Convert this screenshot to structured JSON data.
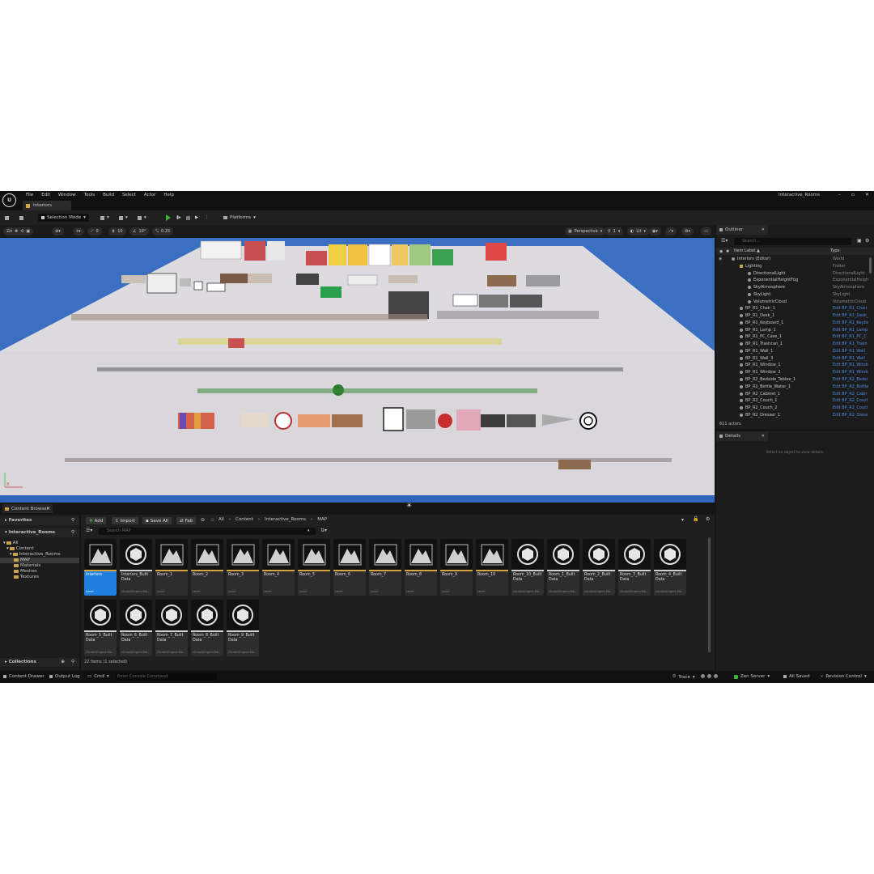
{
  "window": {
    "project": "Interactive_Rooms",
    "doc_tab": "Interiors",
    "controls": [
      "–",
      "▫",
      "✕"
    ]
  },
  "menu": [
    "File",
    "Edit",
    "Window",
    "Tools",
    "Build",
    "Select",
    "Actor",
    "Help"
  ],
  "toolbar": {
    "selection_mode": "Selection Mode",
    "platforms": "Platforms"
  },
  "viewport": {
    "snap_angle": "0",
    "snap_grid": "10",
    "rotate_snap": "10°",
    "scale_snap": "0.25",
    "view_mode": "Perspective",
    "lit": "Lit",
    "cam_speed": "1",
    "axis_x": "X",
    "axis_y": "Y"
  },
  "outliner": {
    "title": "Outliner",
    "search_placeholder": "Search...",
    "col_label": "Item Label ▲",
    "col_type": "Type",
    "rows": [
      {
        "label": "Interiors (Editor)",
        "type": "World",
        "indent": 0,
        "folder": false,
        "link": false
      },
      {
        "label": "Lighting",
        "type": "Folder",
        "indent": 1,
        "folder": true,
        "link": false
      },
      {
        "label": "DirectionalLight",
        "type": "DirectionalLight",
        "indent": 2,
        "folder": false,
        "link": false
      },
      {
        "label": "ExponentialHeightFog",
        "type": "ExponentialHeight",
        "indent": 2,
        "folder": false,
        "link": false
      },
      {
        "label": "SkyAtmosphere",
        "type": "SkyAtmosphere",
        "indent": 2,
        "folder": false,
        "link": false
      },
      {
        "label": "SkyLight",
        "type": "SkyLight",
        "indent": 2,
        "folder": false,
        "link": false
      },
      {
        "label": "VolumetricCloud",
        "type": "VolumetricCloud",
        "indent": 2,
        "folder": false,
        "link": false
      },
      {
        "label": "BP_R1_Chair_1",
        "type": "Edit BP_R1_Chair",
        "indent": 1,
        "folder": false,
        "link": true
      },
      {
        "label": "BP_R1_Desk_1",
        "type": "Edit BP_R1_Desk_",
        "indent": 1,
        "folder": false,
        "link": true
      },
      {
        "label": "BP_R1_Keyboard_1",
        "type": "Edit BP_R1_Keybo",
        "indent": 1,
        "folder": false,
        "link": true
      },
      {
        "label": "BP_R1_Lamp_1",
        "type": "Edit BP_R1_Lamp",
        "indent": 1,
        "folder": false,
        "link": true
      },
      {
        "label": "BP_R1_PC_Case_1",
        "type": "Edit BP_R1_PC_C",
        "indent": 1,
        "folder": false,
        "link": true
      },
      {
        "label": "BP_R1_Trashcan_1",
        "type": "Edit BP_R1_Trash",
        "indent": 1,
        "folder": false,
        "link": true
      },
      {
        "label": "BP_R1_Wall_1",
        "type": "Edit BP_R1_Wall_",
        "indent": 1,
        "folder": false,
        "link": true
      },
      {
        "label": "BP_R1_Wall_3",
        "type": "Edit BP_R1_Wall_",
        "indent": 1,
        "folder": false,
        "link": true
      },
      {
        "label": "BP_R1_Window_1",
        "type": "Edit BP_R1_Windo",
        "indent": 1,
        "folder": false,
        "link": true
      },
      {
        "label": "BP_R1_Window_2",
        "type": "Edit BP_R1_Windo",
        "indent": 1,
        "folder": false,
        "link": true
      },
      {
        "label": "BP_R2_Bedside_Tablee_1",
        "type": "Edit BP_R2_Bedsi",
        "indent": 1,
        "folder": false,
        "link": true
      },
      {
        "label": "BP_R2_Bottle_Water_1",
        "type": "Edit BP_R2_Bottle",
        "indent": 1,
        "folder": false,
        "link": true
      },
      {
        "label": "BP_R2_Cabinet_1",
        "type": "Edit BP_R2_Cabir",
        "indent": 1,
        "folder": false,
        "link": true
      },
      {
        "label": "BP_R2_Couch_1",
        "type": "Edit BP_R2_Coucl",
        "indent": 1,
        "folder": false,
        "link": true
      },
      {
        "label": "BP_R2_Couch_2",
        "type": "Edit BP_R2_Coucl",
        "indent": 1,
        "folder": false,
        "link": true
      },
      {
        "label": "BP_R2_Dresser_1",
        "type": "Edit BP_R2_Dress",
        "indent": 1,
        "folder": false,
        "link": true
      }
    ],
    "count": "611 actors"
  },
  "details": {
    "title": "Details",
    "empty": "Select an object to view details."
  },
  "content_browser": {
    "title": "Content Browser",
    "add": "Add",
    "import": "Import",
    "save_all": "Save All",
    "fab": "Fab",
    "breadcrumbs": [
      "All",
      "›",
      "Content",
      "›",
      "Interactive_Rooms",
      "›",
      "MAP"
    ],
    "search_placeholder": "Search MAP",
    "favorites": "Favorites",
    "project_root": "Interactive_Rooms",
    "collections": "Collections",
    "tree": [
      {
        "label": "All",
        "indent": 0,
        "selected": false
      },
      {
        "label": "Content",
        "indent": 1,
        "selected": false
      },
      {
        "label": "Interactive_Rooms",
        "indent": 2,
        "selected": false
      },
      {
        "label": "MAP",
        "indent": 3,
        "selected": true
      },
      {
        "label": "Materials",
        "indent": 3,
        "selected": false
      },
      {
        "label": "Meshes",
        "indent": 3,
        "selected": false
      },
      {
        "label": "Textures",
        "indent": 3,
        "selected": false
      }
    ],
    "assets": [
      {
        "name": "Interiors",
        "type": "Level",
        "kind": "level",
        "selected": true
      },
      {
        "name": "Interiors_Built Data",
        "type": "(Script)Engine.Ma...",
        "kind": "data",
        "selected": false
      },
      {
        "name": "Room_1",
        "type": "Level",
        "kind": "level",
        "selected": false
      },
      {
        "name": "Room_2",
        "type": "Level",
        "kind": "level",
        "selected": false
      },
      {
        "name": "Room_3",
        "type": "Level",
        "kind": "level",
        "selected": false
      },
      {
        "name": "Room_4",
        "type": "Level",
        "kind": "level",
        "selected": false
      },
      {
        "name": "Room_5",
        "type": "Level",
        "kind": "level",
        "selected": false
      },
      {
        "name": "Room_6",
        "type": "Level",
        "kind": "level",
        "selected": false
      },
      {
        "name": "Room_7",
        "type": "Level",
        "kind": "level",
        "selected": false
      },
      {
        "name": "Room_8",
        "type": "Level",
        "kind": "level",
        "selected": false
      },
      {
        "name": "Room_9",
        "type": "Level",
        "kind": "level",
        "selected": false
      },
      {
        "name": "Room_10",
        "type": "Level",
        "kind": "level",
        "selected": false
      },
      {
        "name": "Room_10_Built Data",
        "type": "(Script)Engine.Ma...",
        "kind": "data",
        "selected": false
      },
      {
        "name": "Room_1_Built Data",
        "type": "(Script)Engine.Ma...",
        "kind": "data",
        "selected": false
      },
      {
        "name": "Room_2_Built Data",
        "type": "(Script)Engine.Ma...",
        "kind": "data",
        "selected": false
      },
      {
        "name": "Room_3_Built Data",
        "type": "(Script)Engine.Ma...",
        "kind": "data",
        "selected": false
      },
      {
        "name": "Room_4_Built Data",
        "type": "(Script)Engine.Ma...",
        "kind": "data",
        "selected": false
      },
      {
        "name": "Room_5_Built Data",
        "type": "(Script)Engine.Ma...",
        "kind": "data",
        "selected": false
      },
      {
        "name": "Room_6_Built Data",
        "type": "(Script)Engine.Ma...",
        "kind": "data",
        "selected": false
      },
      {
        "name": "Room_7_Built Data",
        "type": "(Script)Engine.Ma...",
        "kind": "data",
        "selected": false
      },
      {
        "name": "Room_8_Built Data",
        "type": "(Script)Engine.Ma...",
        "kind": "data",
        "selected": false
      },
      {
        "name": "Room_9_Built Data",
        "type": "(Script)Engine.Ma...",
        "kind": "data",
        "selected": false
      }
    ],
    "count": "22 items (1 selected)"
  },
  "statusbar": {
    "content_drawer": "Content Drawer",
    "output_log": "Output Log",
    "cmd": "Cmd",
    "console_placeholder": "Enter Console Command",
    "trace": "Trace",
    "zen_server": "Zen Server",
    "all_saved": "All Saved",
    "revision_control": "Revision Control"
  },
  "colors": {
    "accent": "#1f7fe0",
    "level_bar": "#d5a640",
    "data_bar": "#cfcfcf",
    "sky": "#3b6fc2",
    "link": "#4f8ce0"
  }
}
